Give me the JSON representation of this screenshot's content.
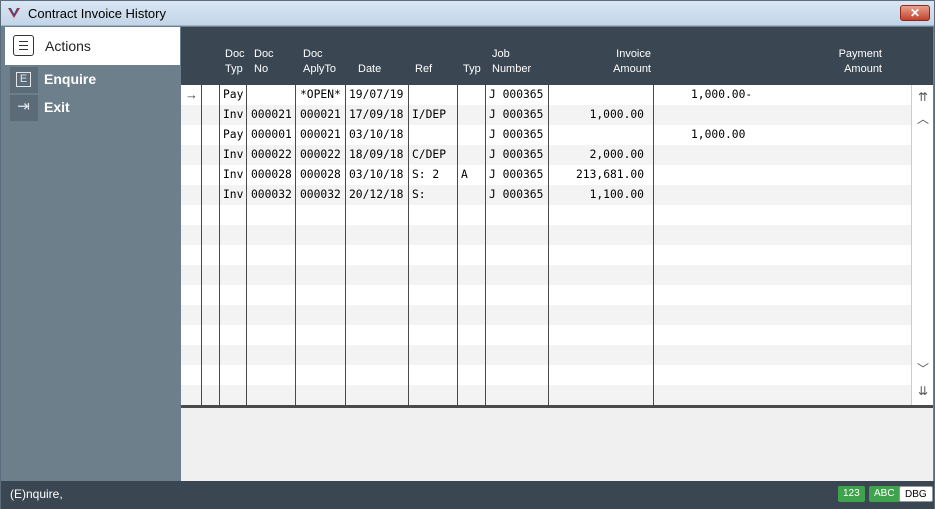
{
  "window": {
    "title": "Contract Invoice History",
    "close_symbol": "✕"
  },
  "sidebar": {
    "header": "Actions",
    "items": [
      {
        "label": "Enquire",
        "icon": "E"
      },
      {
        "label": "Exit",
        "icon": "⇥"
      }
    ]
  },
  "grid": {
    "columns": {
      "doc_typ": [
        "Doc",
        "Typ"
      ],
      "doc_no": [
        "Doc",
        "No"
      ],
      "doc_aplyto": [
        "Doc",
        "AplyTo"
      ],
      "date": "Date",
      "ref": "Ref",
      "typ": "Typ",
      "job_number": [
        "Job",
        "Number"
      ],
      "invoice_amount": [
        "Invoice",
        "Amount"
      ],
      "payment_amount": [
        "Payment",
        "Amount"
      ]
    },
    "current_row_marker": "→",
    "rows": [
      {
        "doc_typ": "Pay",
        "doc_no": "",
        "doc_aplyto": "*OPEN*",
        "date": "19/07/19",
        "ref": "",
        "typ": "",
        "job_number": "J 000365",
        "invoice_amount": "",
        "payment_amount": "1,000.00-"
      },
      {
        "doc_typ": "Inv",
        "doc_no": "000021",
        "doc_aplyto": "000021",
        "date": "17/09/18",
        "ref": "I/DEP",
        "typ": "",
        "job_number": "J 000365",
        "invoice_amount": "1,000.00",
        "payment_amount": ""
      },
      {
        "doc_typ": "Pay",
        "doc_no": "000001",
        "doc_aplyto": "000021",
        "date": "03/10/18",
        "ref": "",
        "typ": "",
        "job_number": "J 000365",
        "invoice_amount": "",
        "payment_amount": "1,000.00"
      },
      {
        "doc_typ": "Inv",
        "doc_no": "000022",
        "doc_aplyto": "000022",
        "date": "18/09/18",
        "ref": "C/DEP",
        "typ": "",
        "job_number": "J 000365",
        "invoice_amount": "2,000.00",
        "payment_amount": ""
      },
      {
        "doc_typ": "Inv",
        "doc_no": "000028",
        "doc_aplyto": "000028",
        "date": "03/10/18",
        "ref": "S: 2",
        "typ": "A",
        "job_number": "J 000365",
        "invoice_amount": "213,681.00",
        "payment_amount": ""
      },
      {
        "doc_typ": "Inv",
        "doc_no": "000032",
        "doc_aplyto": "000032",
        "date": "20/12/18",
        "ref": "S:",
        "typ": "",
        "job_number": "J 000365",
        "invoice_amount": "1,100.00",
        "payment_amount": ""
      }
    ],
    "empty_rows": 10
  },
  "scrollbar": {
    "top": "⇈",
    "up": "︿",
    "down": "﹀",
    "bottom": "⇊"
  },
  "status": {
    "text": "(E)nquire,",
    "badges": [
      "123",
      "ABC",
      "DBG"
    ]
  },
  "colors": {
    "header_bg": "#3a4651",
    "sidebar_bg": "#6e7f8c",
    "badge_green": "#3fa34d"
  }
}
